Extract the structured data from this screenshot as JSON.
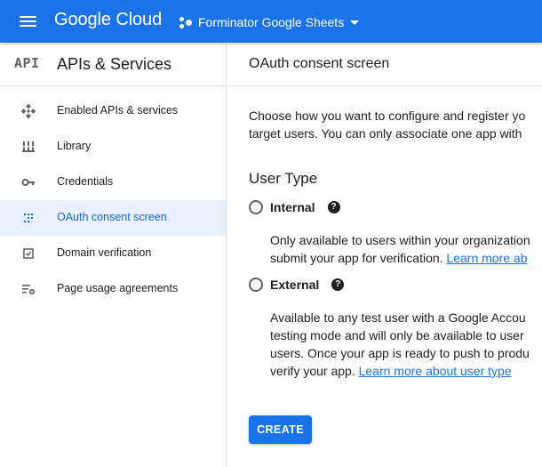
{
  "topbar": {
    "logo": "Google Cloud",
    "project_name": "Forminator Google Sheets",
    "color": "#1a73e8"
  },
  "sidebar": {
    "badge": "API",
    "title": "APIs & Services",
    "items": [
      {
        "label": "Enabled APIs & services",
        "icon": "apis-diamond-icon"
      },
      {
        "label": "Library",
        "icon": "library-grid-icon"
      },
      {
        "label": "Credentials",
        "icon": "key-icon"
      },
      {
        "label": "OAuth consent screen",
        "icon": "consent-dots-icon",
        "active": true
      },
      {
        "label": "Domain verification",
        "icon": "checkbox-icon"
      },
      {
        "label": "Page usage agreements",
        "icon": "settings-list-icon"
      }
    ]
  },
  "main": {
    "title": "OAuth consent screen",
    "intro_line1": "Choose how you want to configure and register yo",
    "intro_line2": "target users. You can only associate one app with",
    "user_type_title": "User Type",
    "options": [
      {
        "label": "Internal",
        "lines": [
          "Only available to users within your organization",
          "submit your app for verification. "
        ],
        "link": "Learn more ab"
      },
      {
        "label": "External",
        "lines": [
          "Available to any test user with a Google Accou",
          "testing mode and will only be available to user",
          "users. Once your app is ready to push to produ",
          "verify your app. "
        ],
        "link": "Learn more about user type"
      }
    ],
    "create_label": "CREATE"
  }
}
